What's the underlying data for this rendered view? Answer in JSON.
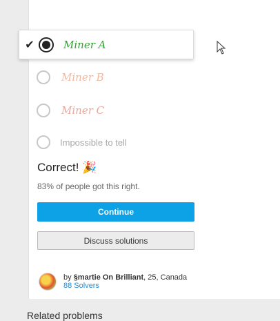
{
  "question": {
    "options": [
      {
        "label": "Miner A",
        "selected": true,
        "check_icon": "checkmark-icon"
      },
      {
        "label": "Miner B",
        "selected": false
      },
      {
        "label": "Miner C",
        "selected": false
      },
      {
        "label": "Impossible to tell",
        "selected": false
      }
    ]
  },
  "result": {
    "heading": "Correct!",
    "emoji": "🎉",
    "stat": "83% of people got this right."
  },
  "buttons": {
    "continue": "Continue",
    "discuss": "Discuss solutions"
  },
  "author": {
    "prefix": "by",
    "name": "§martie On Brilliant",
    "details": ", 25, Canada",
    "solvers": "88 Solvers"
  },
  "related": "Related problems",
  "colors": {
    "correct_green": "#2fa52f",
    "primary_blue": "#0da1e6",
    "link_blue": "#1a8fd6"
  }
}
